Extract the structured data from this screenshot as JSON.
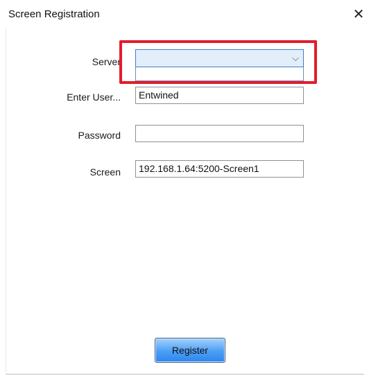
{
  "window": {
    "title": "Screen Registration",
    "close_glyph": "✕"
  },
  "form": {
    "server": {
      "label": "Server",
      "value": "",
      "arrow": "⌵"
    },
    "username": {
      "label": "Enter User...",
      "value": "Entwined"
    },
    "password": {
      "label": "Password",
      "value": ""
    },
    "screen": {
      "label": "Screen",
      "value": "192.168.1.64:5200-Screen1"
    }
  },
  "actions": {
    "register_label": "Register"
  },
  "colors": {
    "highlight": "#e21c2c",
    "combo_focus": "#3f7fc4",
    "button_blue": "#4b9ef5"
  }
}
